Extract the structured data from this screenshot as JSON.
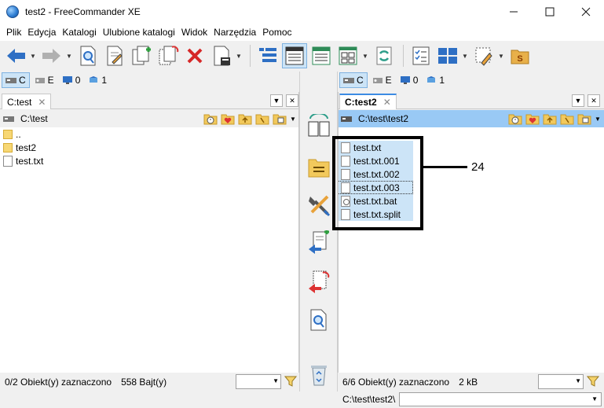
{
  "window": {
    "title": "test2 - FreeCommander XE",
    "minimize": "—",
    "maximize": "☐",
    "close": "✕"
  },
  "menu": [
    "Plik",
    "Edycja",
    "Katalogi",
    "Ulubione katalogi",
    "Widok",
    "Narzędzia",
    "Pomoc"
  ],
  "toolbar_icons": [
    "back-arrow-icon",
    "forward-arrow-icon",
    "view-file-icon",
    "edit-file-icon",
    "copy-file-icon",
    "move-file-icon",
    "delete-icon",
    "properties-icon",
    "tree-view-icon",
    "details-view-icon",
    "list-view-icon",
    "thumbnails-view-icon",
    "sync-icon",
    "checklist-icon",
    "panels-layout-icon",
    "tools-icon",
    "favorites-s-icon"
  ],
  "left": {
    "drives": [
      "C",
      "E",
      "0",
      "1"
    ],
    "tab_label": "C:test",
    "path": "C:\\test",
    "files": [
      {
        "name": "..",
        "type": "folder"
      },
      {
        "name": "test2",
        "type": "folder"
      },
      {
        "name": "test.txt",
        "type": "doc"
      }
    ],
    "status": "0/2 Obiekt(y) zaznaczono",
    "size": "558 Bajt(y)"
  },
  "right": {
    "drives": [
      "C",
      "E",
      "0",
      "1"
    ],
    "tab_label": "C:test2",
    "path": "C:\\test\\test2",
    "files": [
      {
        "name": "test.txt",
        "type": "doc"
      },
      {
        "name": "test.txt.001",
        "type": "doc"
      },
      {
        "name": "test.txt.002",
        "type": "doc"
      },
      {
        "name": "test.txt.003",
        "type": "doc"
      },
      {
        "name": "test.txt.bat",
        "type": "bat"
      },
      {
        "name": "test.txt.split",
        "type": "doc"
      }
    ],
    "status": "6/6 Obiekt(y) zaznaczono",
    "size": "2 kB"
  },
  "cmd_path": "C:\\test\\test2\\",
  "callout_label": "24",
  "colors": {
    "selection": "#cce4f7",
    "active_path": "#99c9f5",
    "accent": "#3c8be3"
  }
}
